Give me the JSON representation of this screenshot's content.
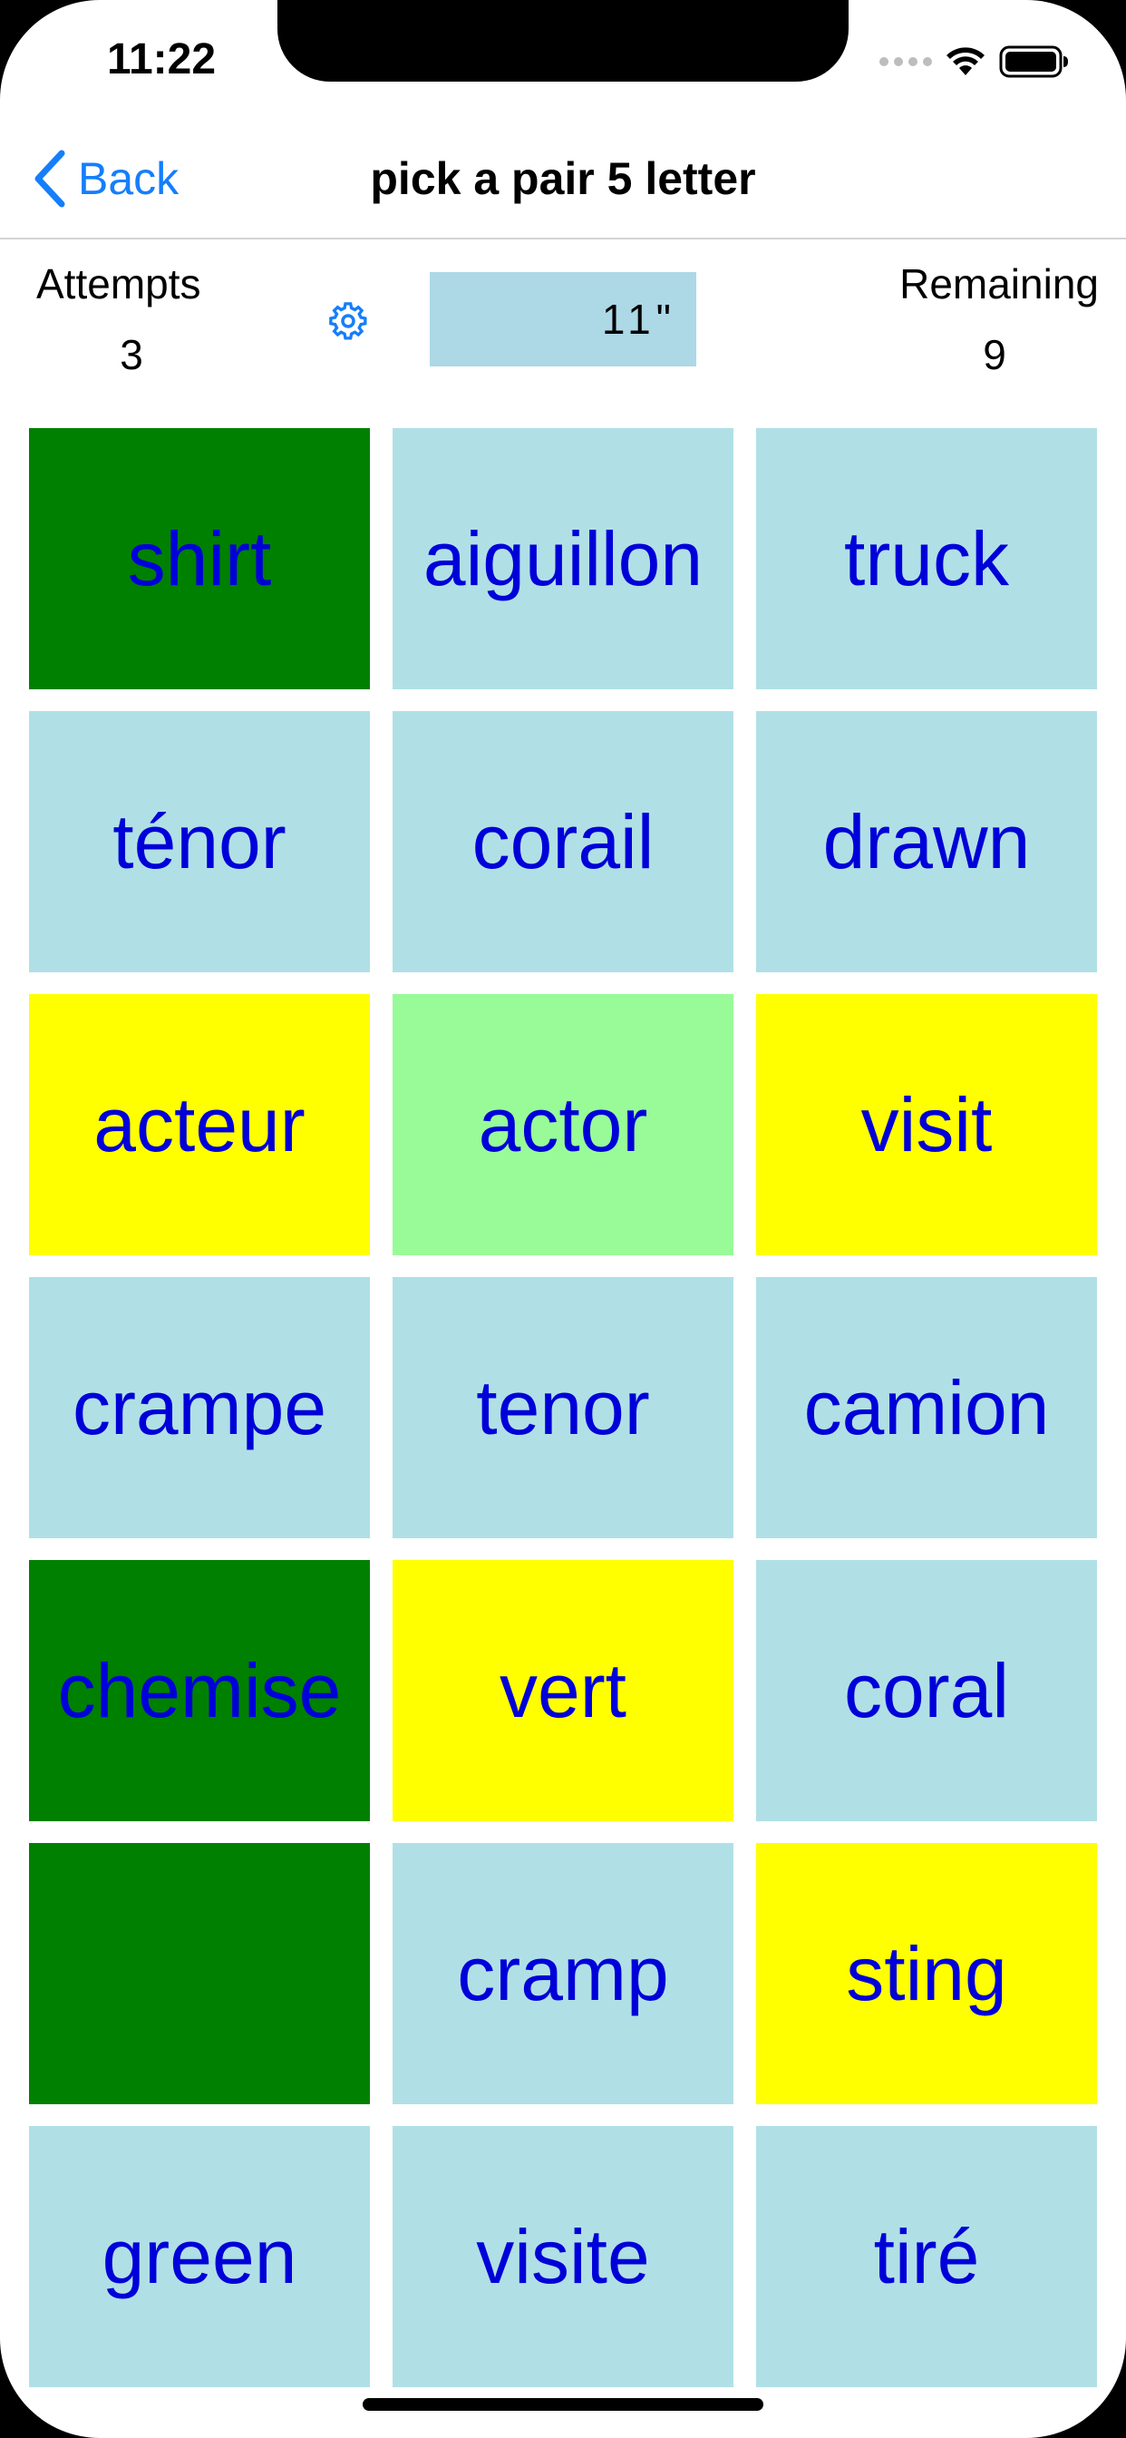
{
  "status_bar": {
    "time": "11:22"
  },
  "nav": {
    "back_label": "Back",
    "title": "pick a pair 5 letter"
  },
  "stats": {
    "attempts_label": "Attempts",
    "attempts_value": "3",
    "timer": "11\"",
    "remaining_label": "Remaining",
    "remaining_value": "9"
  },
  "colors": {
    "accent": "#157efb",
    "tile_default": "#b0e0e6",
    "tile_matched": "#008000",
    "tile_selected": "#ffff00",
    "tile_hint": "#98fb98",
    "tile_text": "#0000d8"
  },
  "tiles": [
    {
      "word": "shirt",
      "state": "matched",
      "color": "#008000"
    },
    {
      "word": "aiguillon",
      "state": "default",
      "color": "#b0e0e6"
    },
    {
      "word": "truck",
      "state": "default",
      "color": "#b0e0e6"
    },
    {
      "word": "ténor",
      "state": "default",
      "color": "#b0e0e6"
    },
    {
      "word": "corail",
      "state": "default",
      "color": "#b0e0e6"
    },
    {
      "word": "drawn",
      "state": "default",
      "color": "#b0e0e6"
    },
    {
      "word": "acteur",
      "state": "selected",
      "color": "#ffff00"
    },
    {
      "word": "actor",
      "state": "hint",
      "color": "#98fb98"
    },
    {
      "word": "visit",
      "state": "selected",
      "color": "#ffff00"
    },
    {
      "word": "crampe",
      "state": "default",
      "color": "#b0e0e6"
    },
    {
      "word": "tenor",
      "state": "default",
      "color": "#b0e0e6"
    },
    {
      "word": "camion",
      "state": "default",
      "color": "#b0e0e6"
    },
    {
      "word": "chemise",
      "state": "matched",
      "color": "#008000"
    },
    {
      "word": "vert",
      "state": "selected",
      "color": "#ffff00"
    },
    {
      "word": "coral",
      "state": "default",
      "color": "#b0e0e6"
    },
    {
      "word": "",
      "state": "matched",
      "color": "#008000"
    },
    {
      "word": "cramp",
      "state": "default",
      "color": "#b0e0e6"
    },
    {
      "word": "sting",
      "state": "selected",
      "color": "#ffff00"
    },
    {
      "word": "green",
      "state": "default",
      "color": "#b0e0e6"
    },
    {
      "word": "visite",
      "state": "default",
      "color": "#b0e0e6"
    },
    {
      "word": "tiré",
      "state": "default",
      "color": "#b0e0e6"
    }
  ]
}
